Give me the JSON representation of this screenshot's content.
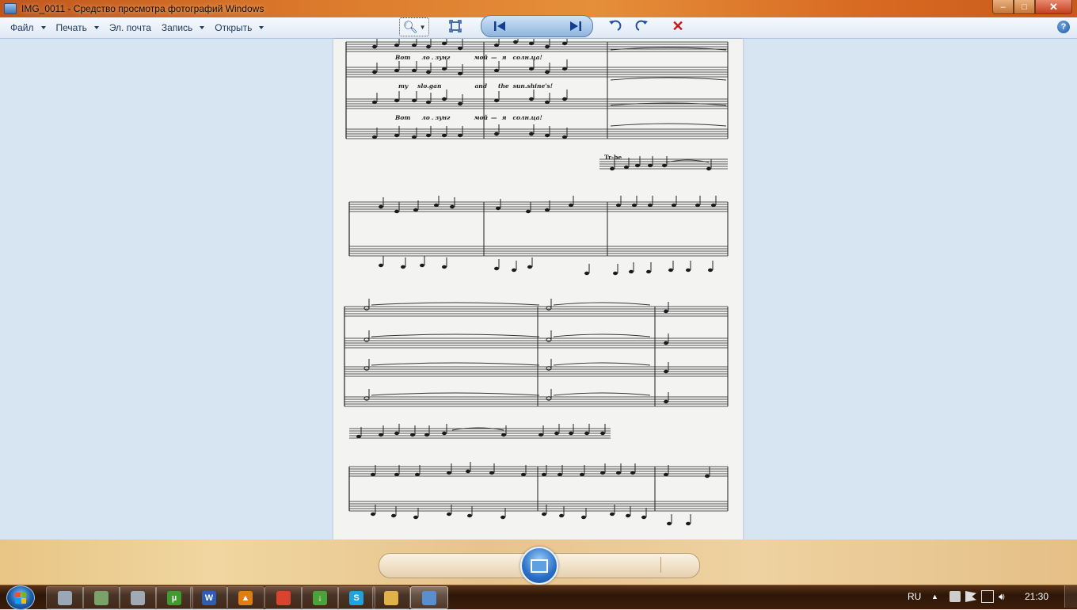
{
  "window": {
    "title": "IMG_0011 - Средство просмотра фотографий Windows",
    "controls": {
      "minimize": "–",
      "maximize": "□",
      "close": "✕"
    }
  },
  "menu": {
    "items": [
      {
        "label": "Файл",
        "has_dropdown": true
      },
      {
        "label": "Печать",
        "has_dropdown": true
      },
      {
        "label": "Эл. почта",
        "has_dropdown": false
      },
      {
        "label": "Запись",
        "has_dropdown": true
      },
      {
        "label": "Открыть",
        "has_dropdown": true
      }
    ],
    "help_icon": "question-mark"
  },
  "score": {
    "lyrics_top_1": [
      "Вот",
      "ло",
      "зунг",
      "мой",
      "—",
      "я",
      "солн",
      "ца!"
    ],
    "lyrics_top_2": [
      "my",
      "slo",
      "gan",
      "and",
      "the",
      "sun",
      "shine's!"
    ],
    "lyrics_top_3": [
      "Вот",
      "ло",
      "зунг",
      "мой",
      "—",
      "я",
      "солн",
      "ца!"
    ],
    "instrument_label": "Tr-be"
  },
  "controls": {
    "zoom": "zoom-icon",
    "fit": "fit-window-icon",
    "previous": "previous-icon",
    "slideshow": "slideshow-icon",
    "next": "next-icon",
    "rotate_left": "rotate-ccw-icon",
    "rotate_right": "rotate-cw-icon",
    "delete": "delete-icon"
  },
  "taskbar": {
    "pinned": [
      {
        "name": "printer-app-icon",
        "color": "#9aa7b6",
        "glyph": ""
      },
      {
        "name": "network-app-icon",
        "color": "#7aa36b",
        "glyph": ""
      },
      {
        "name": "tool-app-icon",
        "color": "#a0aab5",
        "glyph": ""
      },
      {
        "name": "utorrent-icon",
        "color": "#3f9b2e",
        "glyph": "µ"
      },
      {
        "name": "word-icon",
        "color": "#2b5eb6",
        "glyph": "W"
      },
      {
        "name": "vlc-icon",
        "color": "#e27d12",
        "glyph": "▲"
      },
      {
        "name": "chrome-icon",
        "color": "#d9442f",
        "glyph": ""
      },
      {
        "name": "download-app-icon",
        "color": "#4aa23a",
        "glyph": "↓"
      },
      {
        "name": "skype-icon",
        "color": "#1ea3e0",
        "glyph": "S"
      },
      {
        "name": "explorer-folder-icon",
        "color": "#e2b24a",
        "glyph": ""
      },
      {
        "name": "photo-viewer-icon",
        "color": "#5a8fcf",
        "glyph": ""
      }
    ],
    "language": "RU",
    "time": "21:30"
  }
}
